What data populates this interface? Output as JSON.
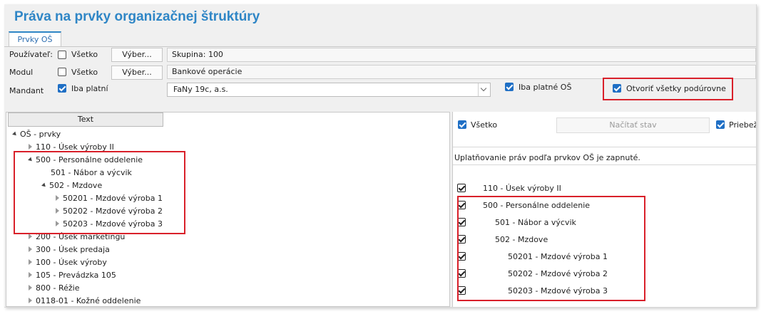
{
  "title": "Práva na prvky organizačnej štruktúry",
  "tab": "Prvky OŠ",
  "filters": {
    "pouzivatel": {
      "label": "Používateľ:",
      "check_label": "Všetko",
      "button": "Výber...",
      "value": "Skupina: 100"
    },
    "modul": {
      "label": "Modul",
      "check_label": "Všetko",
      "button": "Výber...",
      "value": "Bankové operácie"
    },
    "mandant": {
      "label": "Mandant",
      "check_label": "Iba platní",
      "value": "FaNy 19c, a.s."
    },
    "iba_platne": "Iba platné OŠ",
    "otvorit": "Otvoriť všetky podúrovne"
  },
  "tree": {
    "header": "Text",
    "items": {
      "root": "OŠ - prvky",
      "i110": "110 - Úsek výroby II",
      "i500": "500 - Personálne oddelenie",
      "i501": "501 - Nábor a výcvik",
      "i502": "502 - Mzdove",
      "i50201": "50201 - Mzdové výroba 1",
      "i50202": "50202 - Mzdové výroba 2",
      "i50203": "50203 - Mzdové výroba 3",
      "i200": "200 - Úsek marketingu",
      "i300": "300 - Úsek predaja",
      "i100": "100 - Úsek výroby",
      "i105": "105 - Prevádzka 105",
      "i800": "800 - Réžie",
      "i0118": "0118-01 - Kožné oddelenie"
    }
  },
  "right": {
    "vsetko": "Všetko",
    "nacitat": "Načítať stav",
    "priebezne": "Priebež",
    "info": "Uplatňovanie práv podľa prvkov OŠ je zapnuté.",
    "rows": {
      "r110": "110 - Úsek výroby II",
      "r500": "500 - Personálne oddelenie",
      "r501": "501 - Nábor a výcvik",
      "r502": "502 - Mzdove",
      "r50201": "50201 - Mzdové výroba 1",
      "r50202": "50202 - Mzdové výroba 2",
      "r50203": "50203 - Mzdové výroba 3"
    }
  },
  "colors": {
    "title": "#2f86c6",
    "highlight": "#d9202a",
    "checkbox": "#1f6fc5"
  }
}
